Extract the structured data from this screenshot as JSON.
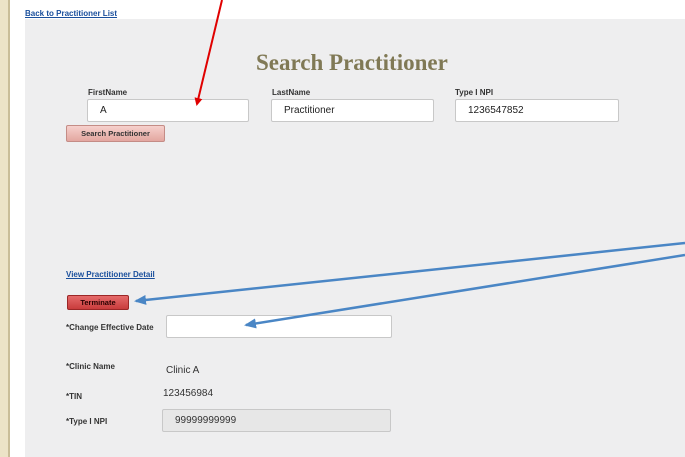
{
  "header": {
    "back_link": "Back to Practitioner List"
  },
  "search": {
    "title": "Search Practitioner",
    "first_name_label": "FirstName",
    "first_name_value": "A",
    "last_name_label": "LastName",
    "last_name_value": "Practitioner",
    "npi_label": "Type I NPI",
    "npi_value": "1236547852",
    "search_button": "Search Practitioner"
  },
  "detail": {
    "view_link": "View Practitioner Detail",
    "terminate_button": "Terminate",
    "change_date_label": "*Change Effective Date",
    "change_date_value": "",
    "clinic_label": "*Clinic Name",
    "clinic_value": "Clinic A",
    "tin_label": "*TIN",
    "tin_value": "123456984",
    "npi_label": "*Type I NPI",
    "npi_value": "99999999999"
  },
  "annotation_colors": {
    "red_arrow": "#e00000",
    "blue_arrows": "#4a86c5"
  }
}
